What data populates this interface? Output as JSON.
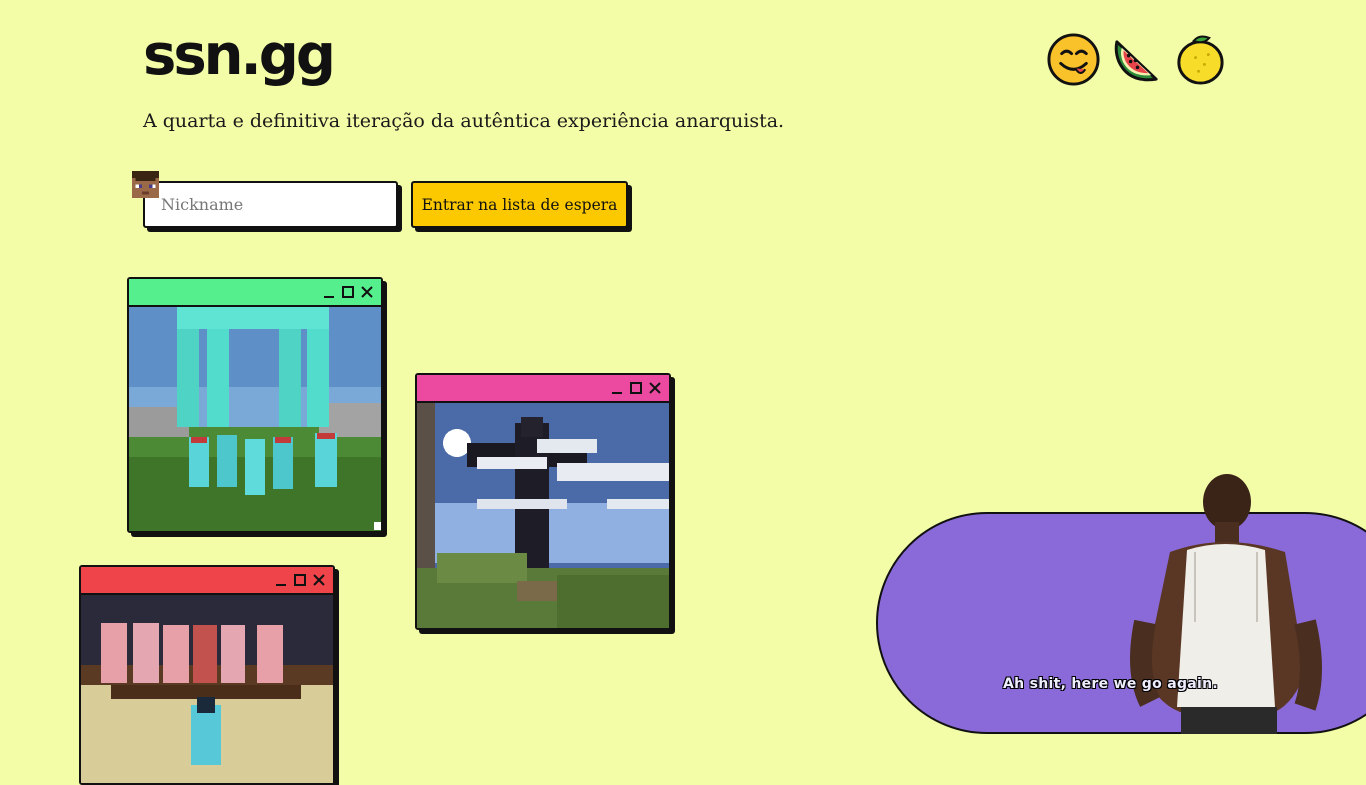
{
  "brand": {
    "name": "ssn.gg"
  },
  "tagline": "A quarta e definitiva iteração da autêntica experiência anarquista.",
  "header_icons": [
    "yum-face-icon",
    "watermelon-icon",
    "lemon-icon"
  ],
  "waitlist": {
    "nickname_placeholder": "Nickname",
    "nickname_value": "",
    "submit_label": "Entrar na lista de espera"
  },
  "gallery": {
    "windows": [
      {
        "name": "screenshot-window-group-diamond",
        "titlebar_color": "#55f08d"
      },
      {
        "name": "screenshot-window-statue",
        "titlebar_color": "#ec4aa1"
      },
      {
        "name": "screenshot-window-armor-stands",
        "titlebar_color": "#ee444a"
      }
    ],
    "controls": [
      "minimize-icon",
      "maximize-icon",
      "close-icon"
    ]
  },
  "promo": {
    "subtitle": "Ah shit, here we go again.",
    "background": "#8a6ad8"
  },
  "colors": {
    "page_background": "#f3fca6",
    "button": "#fcc900",
    "ink": "#111111"
  }
}
